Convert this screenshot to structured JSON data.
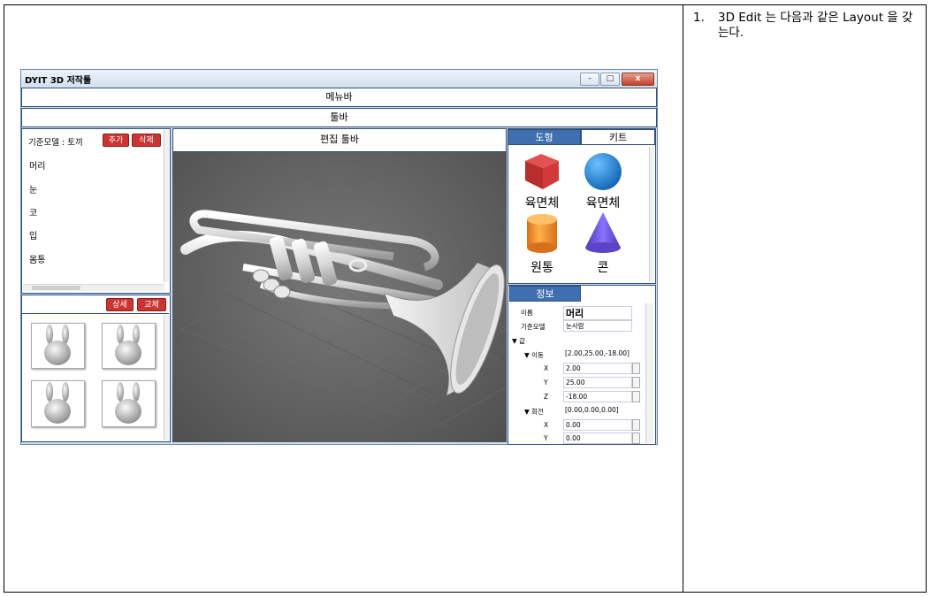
{
  "note": {
    "number": "1.",
    "text": "3D Edit 는 다음과 같은 Layout 을 갖는다."
  },
  "window": {
    "title": "DYIT 3D 저작툴",
    "min_label": "–",
    "max_label": "□",
    "close_label": "x"
  },
  "menubar": {
    "label": "메뉴바"
  },
  "toolbar": {
    "label": "툴바"
  },
  "edit_toolbar": {
    "label": "편집 툴바"
  },
  "model_panel": {
    "header": "기준모델 : 토끼",
    "add_label": "추가",
    "delete_label": "삭제",
    "items": [
      "머리",
      "눈",
      "코",
      "입",
      "몸통"
    ]
  },
  "thumb_panel": {
    "detail_label": "상세",
    "replace_label": "교체"
  },
  "shape_panel": {
    "tabs": [
      "도형",
      "키트"
    ],
    "shapes": [
      "육면체",
      "육면체",
      "원통",
      "콘"
    ],
    "colors": {
      "cube": "#d23a3a",
      "sphere": "#2a8fe0",
      "cylinder": "#f2922a",
      "cone": "#6a4fd6"
    }
  },
  "info_panel": {
    "tab": "정보",
    "name_label": "이름",
    "name_value": "머리",
    "base_label": "기준모델",
    "base_value": "눈사람",
    "value_group": "▼ 값",
    "move_group": "▼ 이동",
    "move_value": "[2.00,25.00,-18.00]",
    "move_x_label": "X",
    "move_x": "2.00",
    "move_y_label": "Y",
    "move_y": "25.00",
    "move_z_label": "Z",
    "move_z": "-18.00",
    "rotate_group": "▼ 회전",
    "rotate_value": "[0.00,0.00,0.00]",
    "rot_x_label": "X",
    "rot_x": "0.00",
    "rot_y_label": "Y",
    "rot_y": "0.00"
  }
}
